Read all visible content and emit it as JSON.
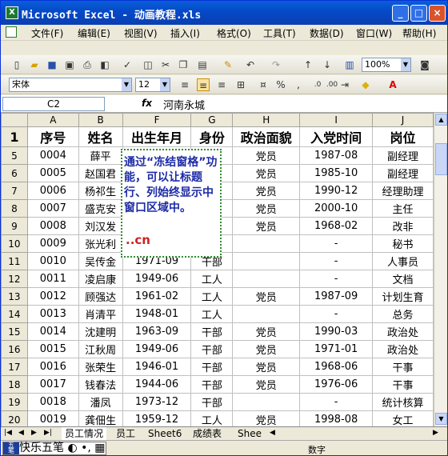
{
  "window": {
    "title": "Microsoft Excel - 动画教程.xls",
    "min": "_",
    "max": "□",
    "close": "×"
  },
  "menu": [
    "文件(F)",
    "编辑(E)",
    "视图(V)",
    "插入(I)",
    "格式(O)",
    "工具(T)",
    "数据(D)",
    "窗口(W)",
    "帮助(H)"
  ],
  "format": {
    "font": "宋体",
    "size": "12",
    "zoom": "100%"
  },
  "formula": {
    "cell": "C2",
    "fx": "fx",
    "value": "河南永城"
  },
  "columns": [
    "A",
    "B",
    "F",
    "G",
    "H",
    "I",
    "J"
  ],
  "header": {
    "row": "1",
    "cells": [
      "序号",
      "姓名",
      "出生年月",
      "身份",
      "政治面貌",
      "入党时间",
      "岗位"
    ]
  },
  "rows": [
    {
      "r": "5",
      "cells": [
        "0004",
        "薛平",
        "",
        "",
        "党员",
        "1987-08",
        "副经理"
      ]
    },
    {
      "r": "6",
      "cells": [
        "0005",
        "赵国君",
        "",
        "",
        "党员",
        "1985-10",
        "副经理"
      ]
    },
    {
      "r": "7",
      "cells": [
        "0006",
        "杨祁生",
        "",
        "",
        "党员",
        "1990-12",
        "经理助理"
      ]
    },
    {
      "r": "8",
      "cells": [
        "0007",
        "盛克安",
        "",
        "",
        "党员",
        "2000-10",
        "主任"
      ]
    },
    {
      "r": "9",
      "cells": [
        "0008",
        "刘汉发",
        "",
        "",
        "党员",
        "1968-02",
        "改非"
      ]
    },
    {
      "r": "10",
      "cells": [
        "0009",
        "张光利",
        "",
        "",
        "",
        "-",
        "秘书"
      ]
    },
    {
      "r": "11",
      "cells": [
        "0010",
        "吴传金",
        "1971-09",
        "干部",
        "",
        "-",
        "人事员"
      ]
    },
    {
      "r": "12",
      "cells": [
        "0011",
        "凌启康",
        "1949-06",
        "工人",
        "",
        "-",
        "文档"
      ]
    },
    {
      "r": "13",
      "cells": [
        "0012",
        "顾强达",
        "1961-02",
        "工人",
        "党员",
        "1987-09",
        "计划生育"
      ]
    },
    {
      "r": "14",
      "cells": [
        "0013",
        "肖清平",
        "1948-01",
        "工人",
        "",
        "-",
        "总务"
      ]
    },
    {
      "r": "15",
      "cells": [
        "0014",
        "沈建明",
        "1963-09",
        "干部",
        "党员",
        "1990-03",
        "政治处"
      ]
    },
    {
      "r": "16",
      "cells": [
        "0015",
        "江秋周",
        "1949-06",
        "干部",
        "党员",
        "1971-01",
        "政治处"
      ]
    },
    {
      "r": "17",
      "cells": [
        "0016",
        "张荣生",
        "1946-01",
        "干部",
        "党员",
        "1968-06",
        "干事"
      ]
    },
    {
      "r": "18",
      "cells": [
        "0017",
        "钱春法",
        "1944-06",
        "干部",
        "党员",
        "1976-06",
        "干事"
      ]
    },
    {
      "r": "19",
      "cells": [
        "0018",
        "潘凤",
        "1973-12",
        "干部",
        "",
        "-",
        "统计核算"
      ]
    },
    {
      "r": "20",
      "cells": [
        "0019",
        "龚佃生",
        "1959-12",
        "工人",
        "党员",
        "1998-08",
        "女工"
      ]
    }
  ],
  "callout": {
    "text": "通过“冻结窗格”功能，可以让标题行、列始终显示中窗口区域中。",
    "logo": "..cn"
  },
  "tabs": [
    "员工情况",
    "员工",
    "Sheet6",
    "成绩表",
    "Shee"
  ],
  "status": {
    "ime": "快乐五笔",
    "mode": "数字"
  }
}
